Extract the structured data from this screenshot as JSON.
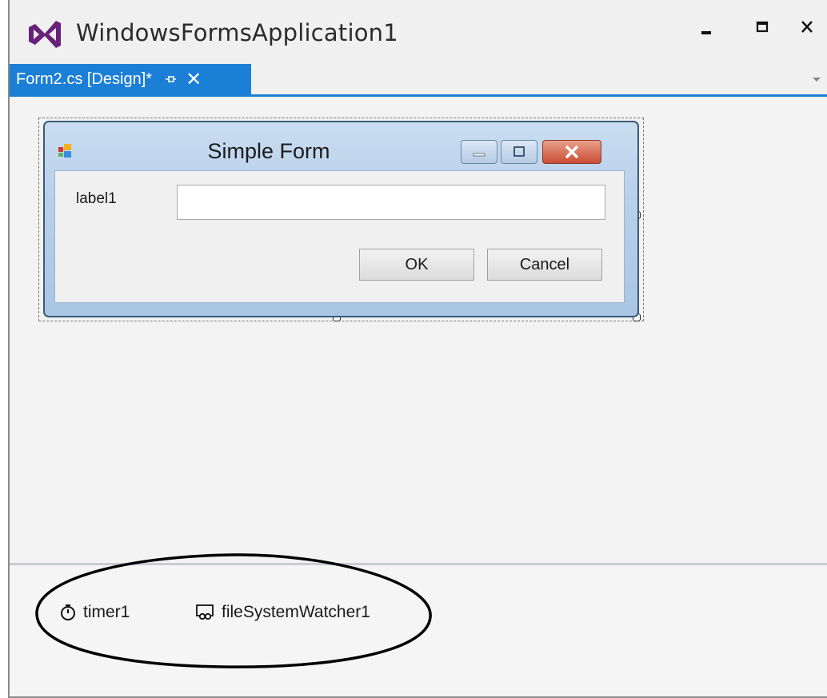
{
  "window": {
    "title": "WindowsFormsApplication1",
    "icon": "visual-studio-logo-icon",
    "buttons": [
      "minimize-icon",
      "maximize-icon",
      "close-icon"
    ]
  },
  "tab": {
    "label": "Form2.cs [Design]*",
    "pin_icon": "pin-icon",
    "close_glyph": "✕",
    "accent": "#1c7fd6"
  },
  "designer_form": {
    "title": "Simple Form",
    "label_text": "label1",
    "textbox_value": "",
    "ok_label": "OK",
    "cancel_label": "Cancel"
  },
  "component_tray": {
    "items": [
      {
        "label": "timer1",
        "icon": "timer-icon"
      },
      {
        "label": "fileSystemWatcher1",
        "icon": "file-system-watcher-icon"
      }
    ]
  },
  "colors": {
    "vs_purple": "#68217a",
    "tab_blue": "#1c7fd6",
    "form_close_red": "#c94d35"
  }
}
